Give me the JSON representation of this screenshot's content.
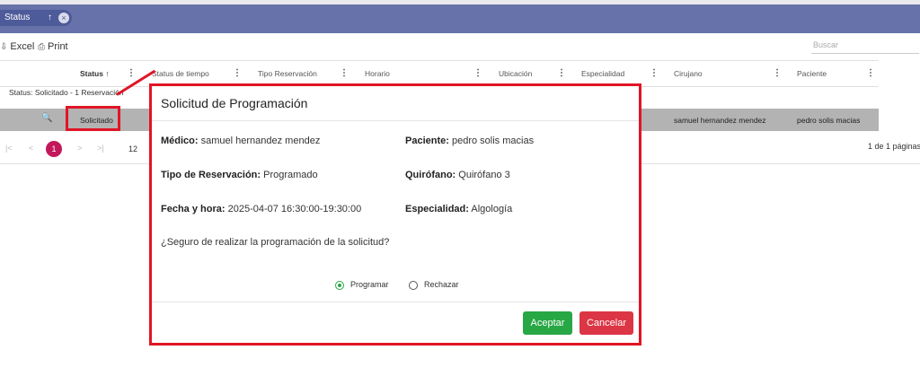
{
  "group_chip": {
    "label": "Status",
    "sort_arrow": "↑",
    "remove": "×"
  },
  "toolbar": {
    "excel_label": "Excel",
    "print_label": "Print",
    "excel_icon": "download-icon",
    "print_icon": "printer-icon"
  },
  "search": {
    "placeholder": "Buscar"
  },
  "columns": [
    {
      "label": "Status",
      "sort": "↑"
    },
    {
      "label": "Status de tiempo"
    },
    {
      "label": "Tipo Reservación"
    },
    {
      "label": "Horario"
    },
    {
      "label": "Ubicación"
    },
    {
      "label": "Especialidad"
    },
    {
      "label": "Cirujano"
    },
    {
      "label": "Paciente"
    }
  ],
  "group_row": {
    "text": "Status: Solicitado - 1 Reservación"
  },
  "row": {
    "status": "Solicitado",
    "cirujano": "samuel hernandez mendez",
    "paciente": "pedro solis macias"
  },
  "pager": {
    "first": "|<",
    "prev": "<",
    "current": "1",
    "next": ">",
    "last": ">|",
    "page_size": "12",
    "info": "1 de 1 páginas"
  },
  "modal": {
    "title": "Solicitud de Programación",
    "medico_label": "Médico:",
    "medico_value": "samuel hernandez mendez",
    "paciente_label": "Paciente:",
    "paciente_value": "pedro solis macias",
    "tipo_label": "Tipo de Reservación:",
    "tipo_value": "Programado",
    "quirofano_label": "Quirófano:",
    "quirofano_value": "Quirófano 3",
    "fecha_label": "Fecha y hora:",
    "fecha_value": "2025-04-07 16:30:00-19:30:00",
    "especialidad_label": "Especialidad:",
    "especialidad_value": "Algología",
    "question": "¿Seguro de realizar la programación de la solicitud?",
    "option_programar": "Programar",
    "option_rechazar": "Rechazar",
    "selected_option": "Programar",
    "accept_label": "Aceptar",
    "cancel_label": "Cancelar"
  },
  "colors": {
    "header_bar": "#6672a9",
    "highlight": "#e01525",
    "accept": "#28a745",
    "cancel": "#dc3545",
    "current_page": "#c2185b"
  }
}
